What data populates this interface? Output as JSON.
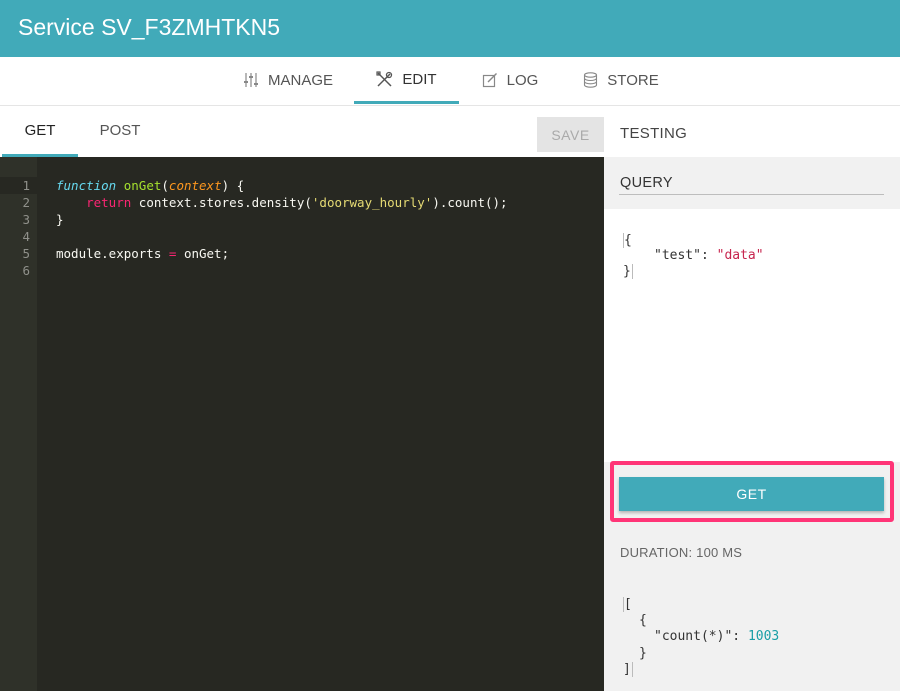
{
  "window": {
    "title": "Service SV_F3ZMHTKN5"
  },
  "nav": {
    "tabs": [
      {
        "label": "MANAGE",
        "icon": "sliders-icon"
      },
      {
        "label": "EDIT",
        "icon": "tools-icon",
        "active": true
      },
      {
        "label": "LOG",
        "icon": "edit-note-icon"
      },
      {
        "label": "STORE",
        "icon": "database-icon"
      }
    ]
  },
  "subnav": {
    "tabs": [
      {
        "label": "GET",
        "active": true
      },
      {
        "label": "POST"
      }
    ],
    "save_label": "SAVE",
    "testing_label": "TESTING"
  },
  "editor": {
    "line_numbers": [
      "1",
      "2",
      "3",
      "4",
      "5",
      "6"
    ],
    "code": {
      "l1_keyword": "function",
      "l1_name": "onGet",
      "l1_open": "(",
      "l1_param": "context",
      "l1_close": ") {",
      "l2_return": "return",
      "l2_call": " context.stores.density(",
      "l2_string": "'doorway_hourly'",
      "l2_end": ").count();",
      "l3": "}",
      "l5_left": "module.exports ",
      "l5_op": "=",
      "l5_right": " onGet;"
    }
  },
  "testing": {
    "query_label": "QUERY",
    "query_json": {
      "open": "{",
      "key": "\"test\"",
      "sep": ": ",
      "value": "\"data\"",
      "close": "}"
    },
    "get_label": "GET",
    "duration": "DURATION: 100 MS",
    "result_json": {
      "open": "[",
      "obj_open": "{",
      "key": "\"count(*)\"",
      "sep": ": ",
      "value": "1003",
      "obj_close": "}",
      "close": "]"
    }
  },
  "colors": {
    "accent": "#41aab9",
    "highlight": "#ff3577",
    "editor_bg": "#272822"
  }
}
